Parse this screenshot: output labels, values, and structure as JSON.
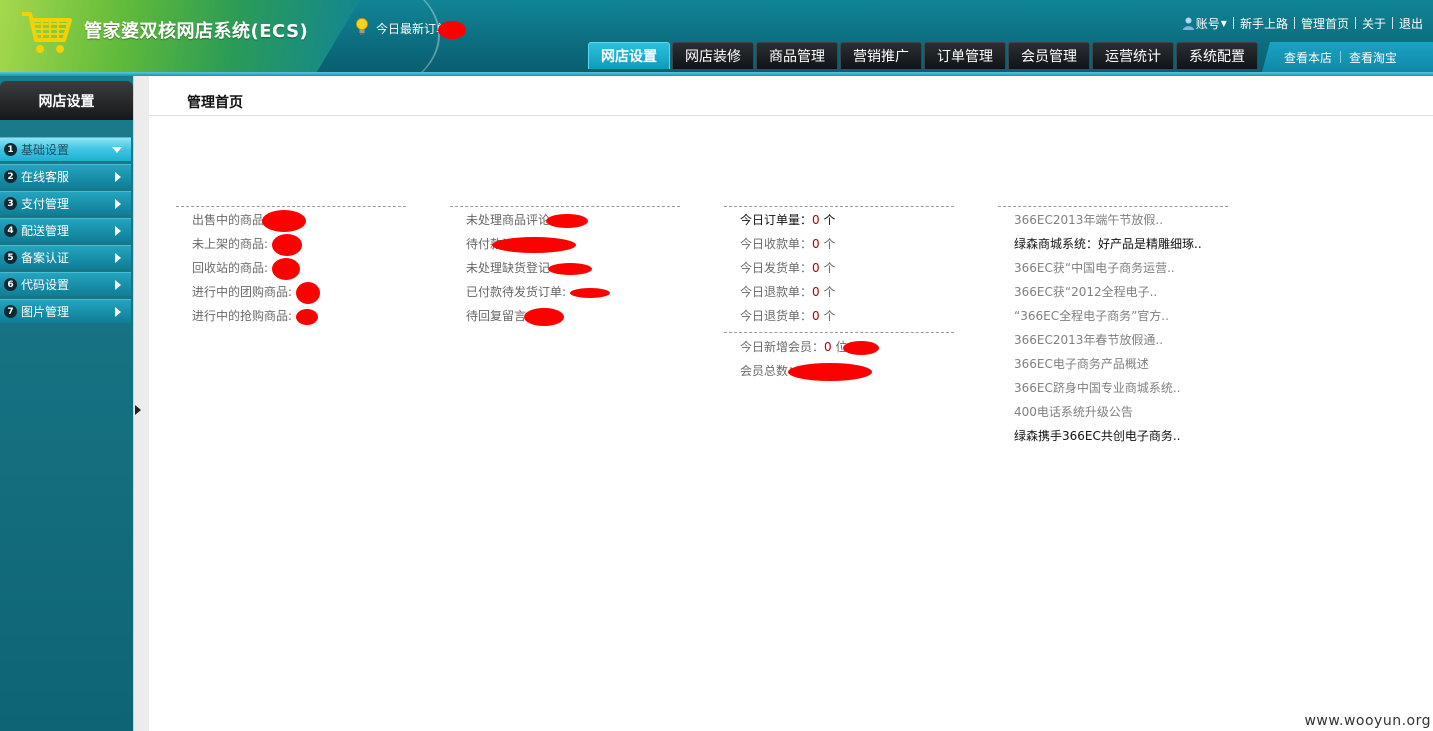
{
  "header": {
    "title": "管家婆双核网店系统(ECS)",
    "notice": "今日最新订单",
    "top_links": [
      "账号",
      "新手上路",
      "管理首页",
      "关于",
      "退出"
    ],
    "nav_tabs": [
      "网店设置",
      "网店装修",
      "商品管理",
      "营销推广",
      "订单管理",
      "会员管理",
      "运营统计",
      "系统配置"
    ],
    "active_tab": "网店设置",
    "shop_links": [
      "查看本店",
      "查看淘宝"
    ]
  },
  "sidebar": {
    "title": "网店设置",
    "items": [
      {
        "num": "1",
        "label": "基础设置"
      },
      {
        "num": "2",
        "label": "在线客服"
      },
      {
        "num": "3",
        "label": "支付管理"
      },
      {
        "num": "4",
        "label": "配送管理"
      },
      {
        "num": "5",
        "label": "备案认证"
      },
      {
        "num": "6",
        "label": "代码设置"
      },
      {
        "num": "7",
        "label": "图片管理"
      }
    ]
  },
  "main": {
    "page_title": "管理首页",
    "goods_stats": [
      "出售中的商品",
      "未上架的商品:",
      "回收站的商品:",
      "进行中的团购商品:",
      "进行中的抢购商品:"
    ],
    "pending_stats": [
      "未处理商品评论",
      "待付款订单",
      "未处理缺货登记",
      "已付款待发货订单:",
      "待回复留言"
    ],
    "today_stats": [
      {
        "label": "今日订单量：",
        "value": "0",
        "unit": "个"
      },
      {
        "label": "今日收款单：",
        "value": "0",
        "unit": "个"
      },
      {
        "label": "今日发货单：",
        "value": "0",
        "unit": "个"
      },
      {
        "label": "今日退款单：",
        "value": "0",
        "unit": "个"
      },
      {
        "label": "今日退货单：",
        "value": "0",
        "unit": "个"
      }
    ],
    "member_stats": [
      {
        "label": "今日新增会员：",
        "value": "0",
        "unit": "位"
      },
      {
        "label": "会员总数："
      }
    ],
    "news": [
      "366EC2013年端午节放假..",
      "绿森商城系统：好产品是精雕细琢..",
      "366EC获“中国电子商务运营..",
      "366EC获“2012全程电子..",
      "“366EC全程电子商务”官方..",
      "366EC2013年春节放假通..",
      "366EC电子商务产品概述",
      "366EC跻身中国专业商城系统..",
      "400电话系统升级公告",
      "绿森携手366EC共创电子商务.."
    ]
  },
  "watermark": "www.wooyun.org",
  "colors": {
    "accent": "#118596",
    "active_tab": "#1fb0d1",
    "count": "#b30000",
    "redaction": "#ff0000"
  }
}
